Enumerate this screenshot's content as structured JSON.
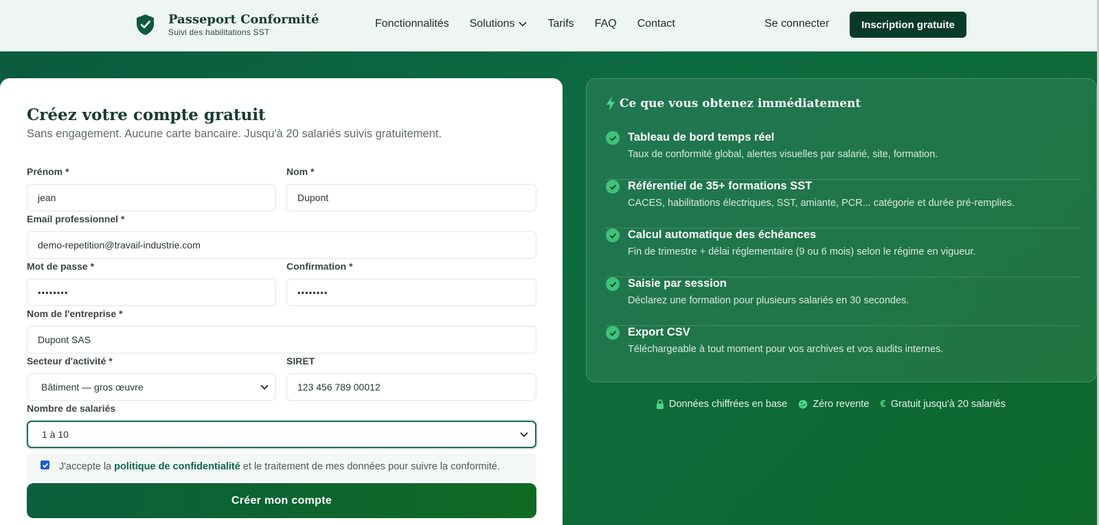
{
  "brand": {
    "name": "Passeport Conformité",
    "tagline": "Suivi des habilitations SST",
    "icon": "shield-check-icon"
  },
  "nav": {
    "items": [
      "Fonctionnalités",
      "Solutions",
      "Tarifs",
      "FAQ",
      "Contact"
    ],
    "login": "Se connecter",
    "signup": "Inscription gratuite"
  },
  "form": {
    "title": "Créez votre compte gratuit",
    "subtitle": "Sans engagement. Aucune carte bancaire. Jusqu'à 20 salariés suivis gratuitement.",
    "first_name": {
      "label": "Prénom *",
      "value": "jean"
    },
    "last_name": {
      "label": "Nom *",
      "value": "Dupont"
    },
    "email": {
      "label": "Email professionnel *",
      "value": "demo-repetition@travail-industrie.com"
    },
    "password": {
      "label": "Mot de passe *",
      "value": "••••••••"
    },
    "confirm": {
      "label": "Confirmation *",
      "value": "••••••••"
    },
    "company": {
      "label": "Nom de l'entreprise *",
      "value": "Dupont SAS"
    },
    "sector": {
      "label": "Secteur d'activité *",
      "value": "Bâtiment — gros œuvre"
    },
    "siret": {
      "label": "SIRET",
      "value": "123 456 789 00012"
    },
    "employees": {
      "label": "Nombre de salariés",
      "value": "1 à 10"
    },
    "consent": {
      "before": "J'accepte la ",
      "link": "politique de confidentialité",
      "after": " et le traitement de mes données pour suivre la conformité.",
      "checked": true
    },
    "submit": "Créer mon compte"
  },
  "panel": {
    "title": "Ce que vous obtenez immédiatement",
    "features": [
      {
        "title": "Tableau de bord temps réel",
        "desc": "Taux de conformité global, alertes visuelles par salarié, site, formation."
      },
      {
        "title": "Référentiel de 35+ formations SST",
        "desc": "CACES, habilitations électriques, SST, amiante, PCR... catégorie et durée pré-remplies."
      },
      {
        "title": "Calcul automatique des échéances",
        "desc": "Fin de trimestre + délai réglementaire (9 ou 6 mois) selon le régime en vigueur."
      },
      {
        "title": "Saisie par session",
        "desc": "Déclarez une formation pour plusieurs salariés en 30 secondes."
      },
      {
        "title": "Export CSV",
        "desc": "Téléchargeable à tout moment pour vos archives et vos audits internes."
      }
    ]
  },
  "trust": [
    {
      "icon": "lock-icon",
      "text": "Données chiffrées en base"
    },
    {
      "icon": "cookie-icon",
      "text": "Zéro revente"
    },
    {
      "icon": "euro-icon",
      "text": "Gratuit jusqu'à 20 salariés"
    }
  ],
  "colors": {
    "brand_dark": "#083b27",
    "accent": "#0f6a43",
    "check": "#3fc27a"
  }
}
